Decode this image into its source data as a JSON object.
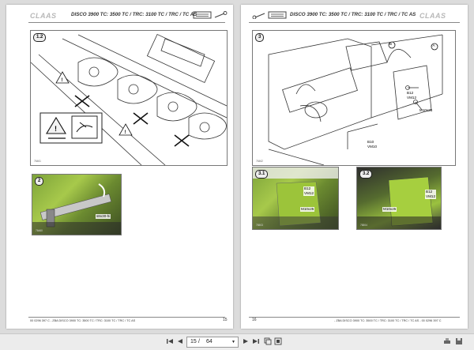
{
  "left_page": {
    "logo": "CLAAS",
    "title": "DISCO 3900 TC: 3500 TC / TRC: 3100 TC / TRC / TC AS",
    "figure1": {
      "badge": "1.2",
      "image_code": "76461"
    },
    "figure2": {
      "badge": "2",
      "label": "s8x30-hi",
      "image_code": "76460"
    },
    "footer": "00 0296 397 C - ZBA DISCO 3900 TC: 3500 TC / TRC: 3100 TC / TRC / TC AS",
    "page_number": "15"
  },
  "right_page": {
    "logo": "CLAAS",
    "title": "DISCO 3900 TC: 3500 TC / TRC: 3100 TC / TRC / TC AS",
    "figure3": {
      "badge": "3",
      "callout_a": "A",
      "callout_b": "B",
      "label_b12": "B12\nVM12",
      "label_m10": "M10x25",
      "label_b10": "B10\nVM10",
      "image_code": "76462"
    },
    "figure31": {
      "badge": "3.1",
      "label_b12": "B12\nVM12",
      "label_m10": "M10x25",
      "image_code": "76503"
    },
    "figure32": {
      "badge": "3.2",
      "label_b12": "B12\nVM12",
      "label_m10": "M10x25",
      "image_code": "76504"
    },
    "footer": "- ZBA DISCO 3900 TC: 3500 TC / TRC: 3100 TC / TRC / TC AS - 00 0296 397 C",
    "page_number": "16"
  },
  "toolbar": {
    "first_icon": "first-page-icon",
    "prev_icon": "previous-page-icon",
    "current_page": "15",
    "separator": "/",
    "total_pages": "64",
    "next_icon": "next-page-icon",
    "last_icon": "last-page-icon",
    "right_icons": [
      "copy-icon",
      "fit-page-icon",
      "print-icon",
      "save-icon"
    ]
  }
}
